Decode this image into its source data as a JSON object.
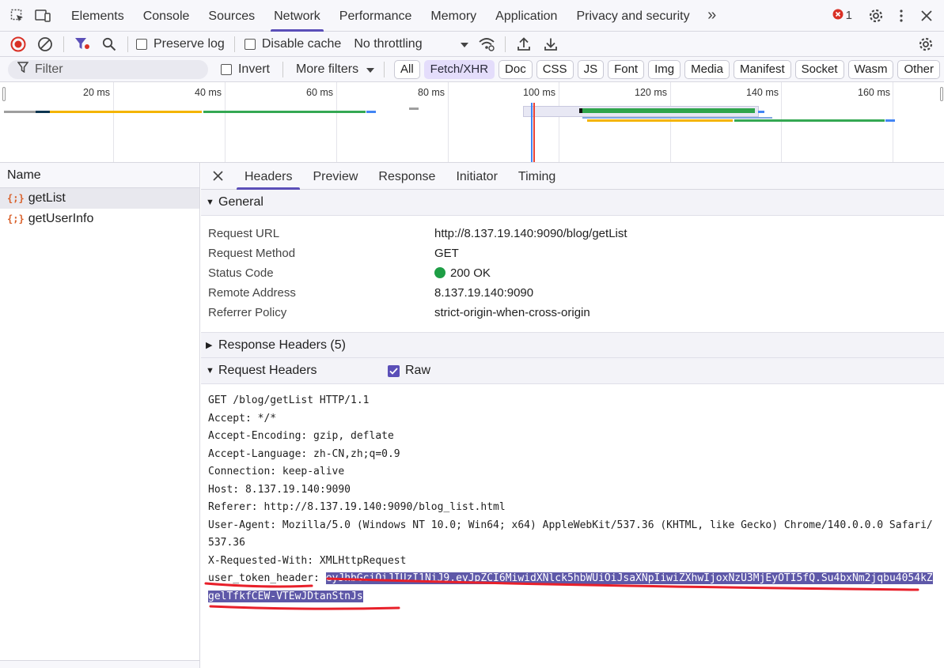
{
  "main_tabs": [
    "Elements",
    "Console",
    "Sources",
    "Network",
    "Performance",
    "Memory",
    "Application",
    "Privacy and security"
  ],
  "active_main_tab": "Network",
  "error_count": "1",
  "toolbar": {
    "preserve_log": "Preserve log",
    "disable_cache": "Disable cache",
    "throttling": "No throttling"
  },
  "filter": {
    "placeholder": "Filter",
    "invert": "Invert",
    "more_filters": "More filters",
    "chips": [
      "All",
      "Fetch/XHR",
      "Doc",
      "CSS",
      "JS",
      "Font",
      "Img",
      "Media",
      "Manifest",
      "Socket",
      "Wasm",
      "Other"
    ],
    "selected_chip": "Fetch/XHR"
  },
  "overview": {
    "tick_labels": [
      "20 ms",
      "40 ms",
      "60 ms",
      "80 ms",
      "100 ms",
      "120 ms",
      "140 ms",
      "160 ms"
    ]
  },
  "requests": {
    "header": "Name",
    "items": [
      {
        "name": "getList",
        "selected": true
      },
      {
        "name": "getUserInfo",
        "selected": false
      }
    ]
  },
  "detail": {
    "tabs": [
      "Headers",
      "Preview",
      "Response",
      "Initiator",
      "Timing"
    ],
    "active_tab": "Headers",
    "general": {
      "title": "General",
      "rows": [
        {
          "key": "Request URL",
          "value": "http://8.137.19.140:9090/blog/getList"
        },
        {
          "key": "Request Method",
          "value": "GET"
        },
        {
          "key": "Status Code",
          "value": "200 OK"
        },
        {
          "key": "Remote Address",
          "value": "8.137.19.140:9090"
        },
        {
          "key": "Referrer Policy",
          "value": "strict-origin-when-cross-origin"
        }
      ]
    },
    "response_headers_title": "Response Headers (5)",
    "request_headers_title": "Request Headers",
    "raw_label": "Raw",
    "raw_lines": [
      "GET /blog/getList HTTP/1.1",
      "Accept: */*",
      "Accept-Encoding: gzip, deflate",
      "Accept-Language: zh-CN,zh;q=0.9",
      "Connection: keep-alive",
      "Host: 8.137.19.140:9090",
      "Referer: http://8.137.19.140:9090/blog_list.html",
      "User-Agent: Mozilla/5.0 (Windows NT 10.0; Win64; x64) AppleWebKit/537.36 (KHTML, like Gecko) Chrome/140.0.0.0 Safari/537.36",
      "X-Requested-With: XMLHttpRequest"
    ],
    "token_header_name": "user_token_header: ",
    "token_header_value": "eyJhbGciOiJIUzI1NiJ9.eyJpZCI6MiwidXNlck5hbWUiOiJsaXNpIiwiZXhwIjoxNzU3MjEyOTI5fQ.Su4bxNm2jqbu4054kZgelTfkfCEW-VTEwJDtanStnJs"
  },
  "colors": {
    "accent": "#5b4fb8",
    "status_ok": "#1e9e45",
    "recording": "#d93025",
    "annotation": "#e8202a"
  }
}
